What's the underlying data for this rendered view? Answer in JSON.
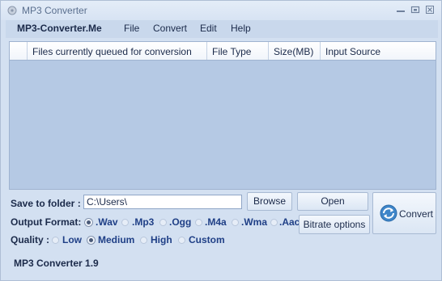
{
  "window": {
    "title": "MP3 Converter"
  },
  "menubar": {
    "brand": "MP3-Converter.Me",
    "items": [
      {
        "label": "File"
      },
      {
        "label": "Convert"
      },
      {
        "label": "Edit"
      },
      {
        "label": "Help"
      }
    ]
  },
  "queue": {
    "columns": [
      {
        "label": ""
      },
      {
        "label": "Files currently queued for conversion"
      },
      {
        "label": "File Type"
      },
      {
        "label": "Size(MB)"
      },
      {
        "label": "Input Source"
      }
    ],
    "rows": []
  },
  "save": {
    "label": "Save to folder :",
    "path": "C:\\Users\\",
    "browse_label": "Browse",
    "open_label": "Open"
  },
  "output_format": {
    "label": "Output Format:",
    "selected": ".Wav",
    "options": [
      {
        "label": ".Wav"
      },
      {
        "label": ".Mp3"
      },
      {
        "label": ".Ogg"
      },
      {
        "label": ".M4a"
      },
      {
        "label": ".Wma"
      },
      {
        "label": ".Aac"
      }
    ]
  },
  "quality": {
    "label": "Quality :",
    "selected": "Medium",
    "options": [
      {
        "label": "Low"
      },
      {
        "label": "Medium"
      },
      {
        "label": "High"
      },
      {
        "label": "Custom"
      }
    ]
  },
  "actions": {
    "bitrate_label": "Bitrate options",
    "convert_label": "Convert"
  },
  "status": {
    "version": "MP3 Converter 1.9"
  },
  "colors": {
    "window_bg": "#d3e0f1",
    "grid_bg": "#b5c9e4",
    "option_text": "#1f3f86"
  },
  "icons": [
    "app-icon",
    "minimize-icon",
    "maximize-icon",
    "close-icon",
    "convert-icon"
  ]
}
